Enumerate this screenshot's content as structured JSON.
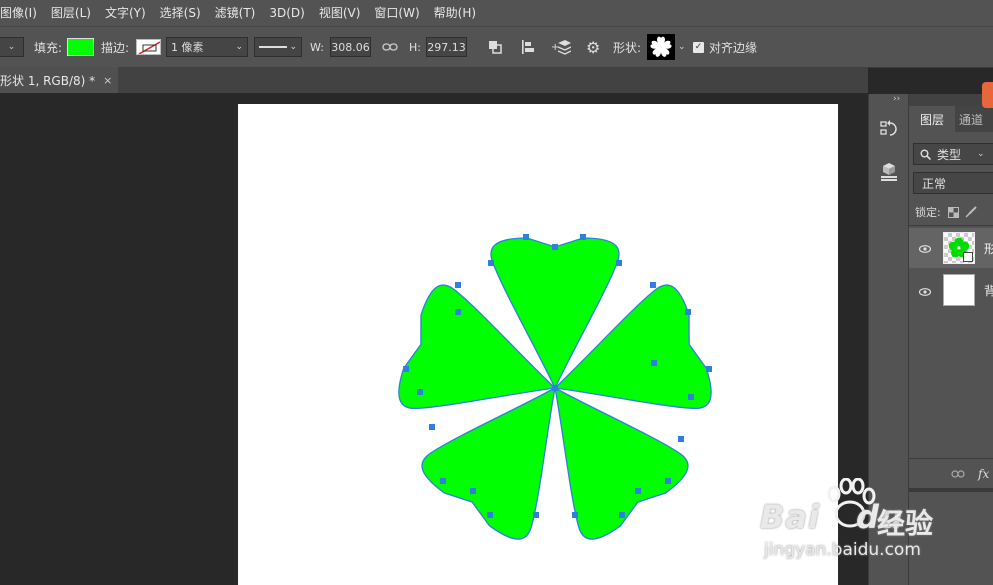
{
  "menu": [
    "图像(I)",
    "图层(L)",
    "文字(Y)",
    "选择(S)",
    "滤镜(T)",
    "3D(D)",
    "视图(V)",
    "窗口(W)",
    "帮助(H)"
  ],
  "options": {
    "fill_label": "填充:",
    "fill_color": "#00ff00",
    "stroke_label": "描边:",
    "stroke_width": "1 像素",
    "w_label": "W:",
    "w_value": "308.06",
    "h_label": "H:",
    "h_value": "297.13",
    "shape_label": "形状:",
    "align_edges_label": "对齐边缘",
    "align_edges_checked": true
  },
  "document": {
    "tab_title": "形状 1, RGB/8) *"
  },
  "canvas": {
    "shape_fill": "#00ff00",
    "path_color": "#2f7fe0",
    "petal_count": 5
  },
  "layers_panel": {
    "tabs": [
      "图层",
      "通道"
    ],
    "filter_kind": "类型",
    "blend_mode": "正常",
    "lock_label": "锁定:",
    "layers": [
      {
        "name": "形",
        "type": "shape"
      },
      {
        "name": "背",
        "type": "background"
      }
    ],
    "footer_fx": "fx"
  },
  "watermark": {
    "brand": "Bai",
    "brand2": "du",
    "cn": "经验",
    "url": "jingyan.baidu.com"
  }
}
